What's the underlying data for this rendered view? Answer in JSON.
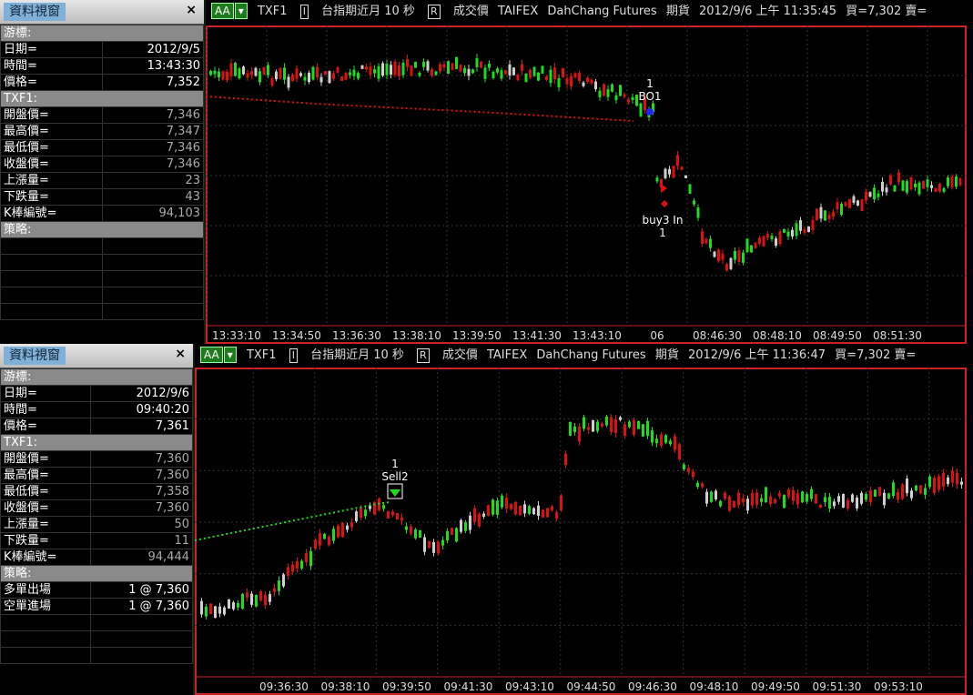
{
  "top": {
    "side": {
      "title": "資料視窗",
      "close": "×",
      "cursor_header": "游標:",
      "rows": [
        {
          "label": "日期=",
          "value": "2012/9/5"
        },
        {
          "label": "時間=",
          "value": "13:43:30"
        },
        {
          "label": "價格=",
          "value": "7,352"
        }
      ],
      "symbol_header": "TXF1:",
      "stats": [
        {
          "label": "開盤價=",
          "value": "7,346"
        },
        {
          "label": "最高價=",
          "value": "7,347"
        },
        {
          "label": "最低價=",
          "value": "7,346"
        },
        {
          "label": "收盤價=",
          "value": "7,346"
        },
        {
          "label": "上漲量=",
          "value": "23"
        },
        {
          "label": "下跌量=",
          "value": "43"
        },
        {
          "label": "K棒編號=",
          "value": "94,103"
        }
      ],
      "strategy_header": "策略:",
      "strategy_rows": []
    },
    "toolbar": {
      "aa": "AA",
      "symbol": "TXF1",
      "ibox": "I",
      "period": "台指期近月 10 秒",
      "rbox": "R",
      "price_type": "成交價",
      "exchange": "TAIFEX",
      "broker": "DahChang Futures",
      "kind": "期貨",
      "datetime": "2012/9/6 上午 11:35:45",
      "quote": "買=7,302 賣="
    },
    "times": [
      "13:33:10",
      "13:34:50",
      "13:36:30",
      "13:38:10",
      "13:39:50",
      "13:41:30",
      "13:43:10",
      "06",
      "08:46:30",
      "08:48:10",
      "08:49:50",
      "08:51:30"
    ],
    "markers": {
      "bo1_count": "1",
      "bo1_label": "BO1",
      "buy_label": "buy3 In",
      "buy_count": "1"
    }
  },
  "bottom": {
    "side": {
      "title": "資料視窗",
      "close": "×",
      "cursor_header": "游標:",
      "rows": [
        {
          "label": "日期=",
          "value": "2012/9/6"
        },
        {
          "label": "時間=",
          "value": "09:40:20"
        },
        {
          "label": "價格=",
          "value": "7,361"
        }
      ],
      "symbol_header": "TXF1:",
      "stats": [
        {
          "label": "開盤價=",
          "value": "7,360"
        },
        {
          "label": "最高價=",
          "value": "7,360"
        },
        {
          "label": "最低價=",
          "value": "7,358"
        },
        {
          "label": "收盤價=",
          "value": "7,360"
        },
        {
          "label": "上漲量=",
          "value": "50"
        },
        {
          "label": "下跌量=",
          "value": "11"
        },
        {
          "label": "K棒編號=",
          "value": "94,444"
        }
      ],
      "strategy_header": "策略:",
      "strategy_rows": [
        {
          "label": "多單出場",
          "value": "1 @ 7,360"
        },
        {
          "label": "空單進場",
          "value": "1 @ 7,360"
        }
      ]
    },
    "toolbar": {
      "aa": "AA",
      "symbol": "TXF1",
      "ibox": "I",
      "period": "台指期近月 10 秒",
      "rbox": "R",
      "price_type": "成交價",
      "exchange": "TAIFEX",
      "broker": "DahChang Futures",
      "kind": "期貨",
      "datetime": "2012/9/6 上午 11:36:47",
      "quote": "買=7,302 賣="
    },
    "times": [
      "09:36:30",
      "09:38:10",
      "09:39:50",
      "09:41:30",
      "09:43:10",
      "09:44:50",
      "09:46:30",
      "09:48:10",
      "09:49:50",
      "09:51:30",
      "09:53:10"
    ],
    "markers": {
      "sell_count": "1",
      "sell_label": "Sell2"
    }
  },
  "colors": {
    "up": "#e01010",
    "down": "#19e019",
    "flat": "#cfcfcf",
    "border": "#cc2222",
    "grid": "#333333"
  }
}
